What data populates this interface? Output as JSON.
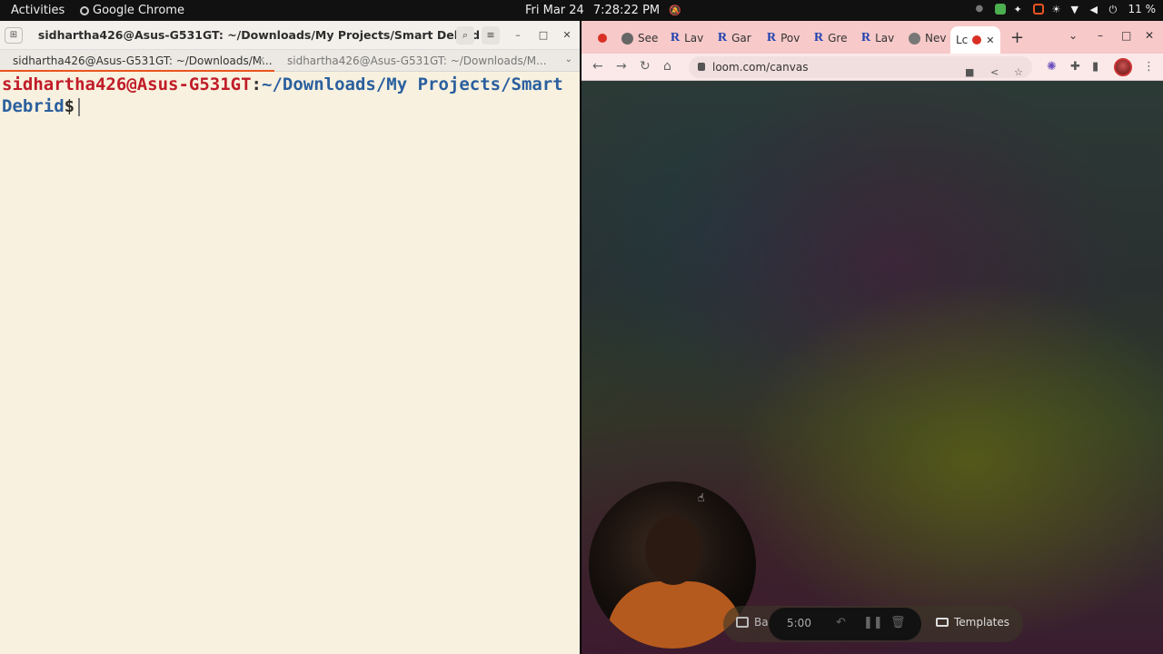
{
  "topbar": {
    "activities": "Activities",
    "app_name": "Google Chrome",
    "date": "Fri Mar 24",
    "time": "7:28:22 PM",
    "battery": "11 %"
  },
  "terminal": {
    "window_title": "sidhartha426@Asus-G531GT: ~/Downloads/My Projects/Smart Debrid",
    "tabs": [
      {
        "label": "sidhartha426@Asus-G531GT: ~/Downloads/M..."
      },
      {
        "label": "sidhartha426@Asus-G531GT: ~/Downloads/M..."
      }
    ],
    "prompt_user": "sidhartha426@Asus-G531GT",
    "prompt_sep": ":",
    "prompt_path": "~/Downloads/My Projects/Smart Debrid",
    "prompt_symbol": "$"
  },
  "chrome": {
    "tabs": [
      {
        "label": "See"
      },
      {
        "label": "Lav"
      },
      {
        "label": "Gar"
      },
      {
        "label": "Pov"
      },
      {
        "label": "Gre"
      },
      {
        "label": "Lav"
      },
      {
        "label": "Nev"
      },
      {
        "label": "Lc"
      }
    ],
    "url": "loom.com/canvas",
    "colors": {
      "tabstrip": "#f7c9c9",
      "record_red": "#d93025",
      "accent_orange": "#e95420"
    }
  },
  "loom": {
    "background_label": "Ba",
    "timer": "5:00",
    "templates_label": "Templates"
  }
}
